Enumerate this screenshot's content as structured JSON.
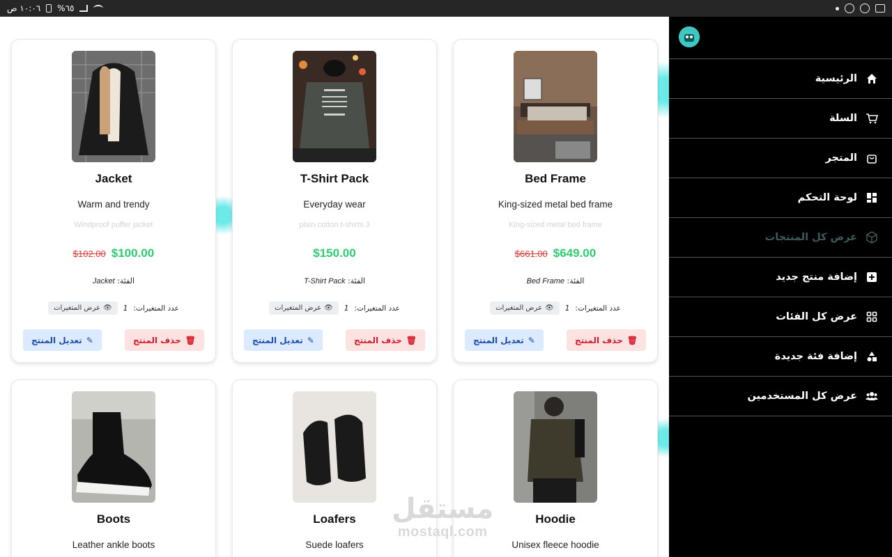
{
  "status_bar": {
    "time": "١٠:٠٦ ص",
    "battery": "%٦٥"
  },
  "products": [
    {
      "name": "Jacket",
      "subtitle": "Warm and trendy",
      "description": "Windproof puffer jacket",
      "old_price": "$102.00",
      "price": "$100.00",
      "category_label": "الفئة:",
      "category": "Jacket",
      "variants_label": "عدد المتغيرات:",
      "variants_count": "1",
      "view_variants": "عرض المتغيرات",
      "delete_label": "حذف المنتج",
      "edit_label": "تعديل المنتج",
      "image": "jacket-photo"
    },
    {
      "name": "T-Shirt Pack",
      "subtitle": "Everyday wear",
      "description": "plain cotton t-shirts 3",
      "old_price": "",
      "price": "$150.00",
      "category_label": "الفئة:",
      "category": "T-Shirt Pack",
      "variants_label": "عدد المتغيرات:",
      "variants_count": "1",
      "view_variants": "عرض المتغيرات",
      "delete_label": "حذف المنتج",
      "edit_label": "تعديل المنتج",
      "image": "tshirt-photo"
    },
    {
      "name": "Bed Frame",
      "subtitle": "King-sized metal bed frame",
      "description": "King-sized metal bed frame",
      "old_price": "$661.00",
      "price": "$649.00",
      "category_label": "الفئة:",
      "category": "Bed Frame",
      "variants_label": "عدد المتغيرات:",
      "variants_count": "1",
      "view_variants": "عرض المتغيرات",
      "delete_label": "حذف المنتج",
      "edit_label": "تعديل المنتج",
      "image": "bed-photo"
    },
    {
      "name": "Boots",
      "subtitle": "Leather ankle boots",
      "image": "boots-photo"
    },
    {
      "name": "Loafers",
      "subtitle": "Suede loafers",
      "image": "loafers-photo"
    },
    {
      "name": "Hoodie",
      "subtitle": "Unisex fleece hoodie",
      "image": "hoodie-photo"
    }
  ],
  "watermark": {
    "arabic": "مستقل",
    "latin": "mostaql.com"
  },
  "sidebar": {
    "items": [
      {
        "label": "الرئيسية",
        "icon": "home-icon"
      },
      {
        "label": "السلة",
        "icon": "cart-icon"
      },
      {
        "label": "المتجر",
        "icon": "bag-icon"
      },
      {
        "label": "لوحة التحكم",
        "icon": "dashboard-icon"
      },
      {
        "label": "عرض كل المنتجات",
        "icon": "box-icon",
        "active": true
      },
      {
        "label": "إضافة منتج جديد",
        "icon": "plus-square-icon"
      },
      {
        "label": "عرض كل الفئات",
        "icon": "grid-icon"
      },
      {
        "label": "إضافة فئة جديدة",
        "icon": "shapes-icon"
      },
      {
        "label": "عرض كل المستخدمين",
        "icon": "users-icon"
      }
    ]
  },
  "colors": {
    "accent_green": "#2ecc71",
    "danger": "#d61f2c",
    "edit_blue": "#1e4fa8",
    "sidebar_bg": "#000000"
  }
}
